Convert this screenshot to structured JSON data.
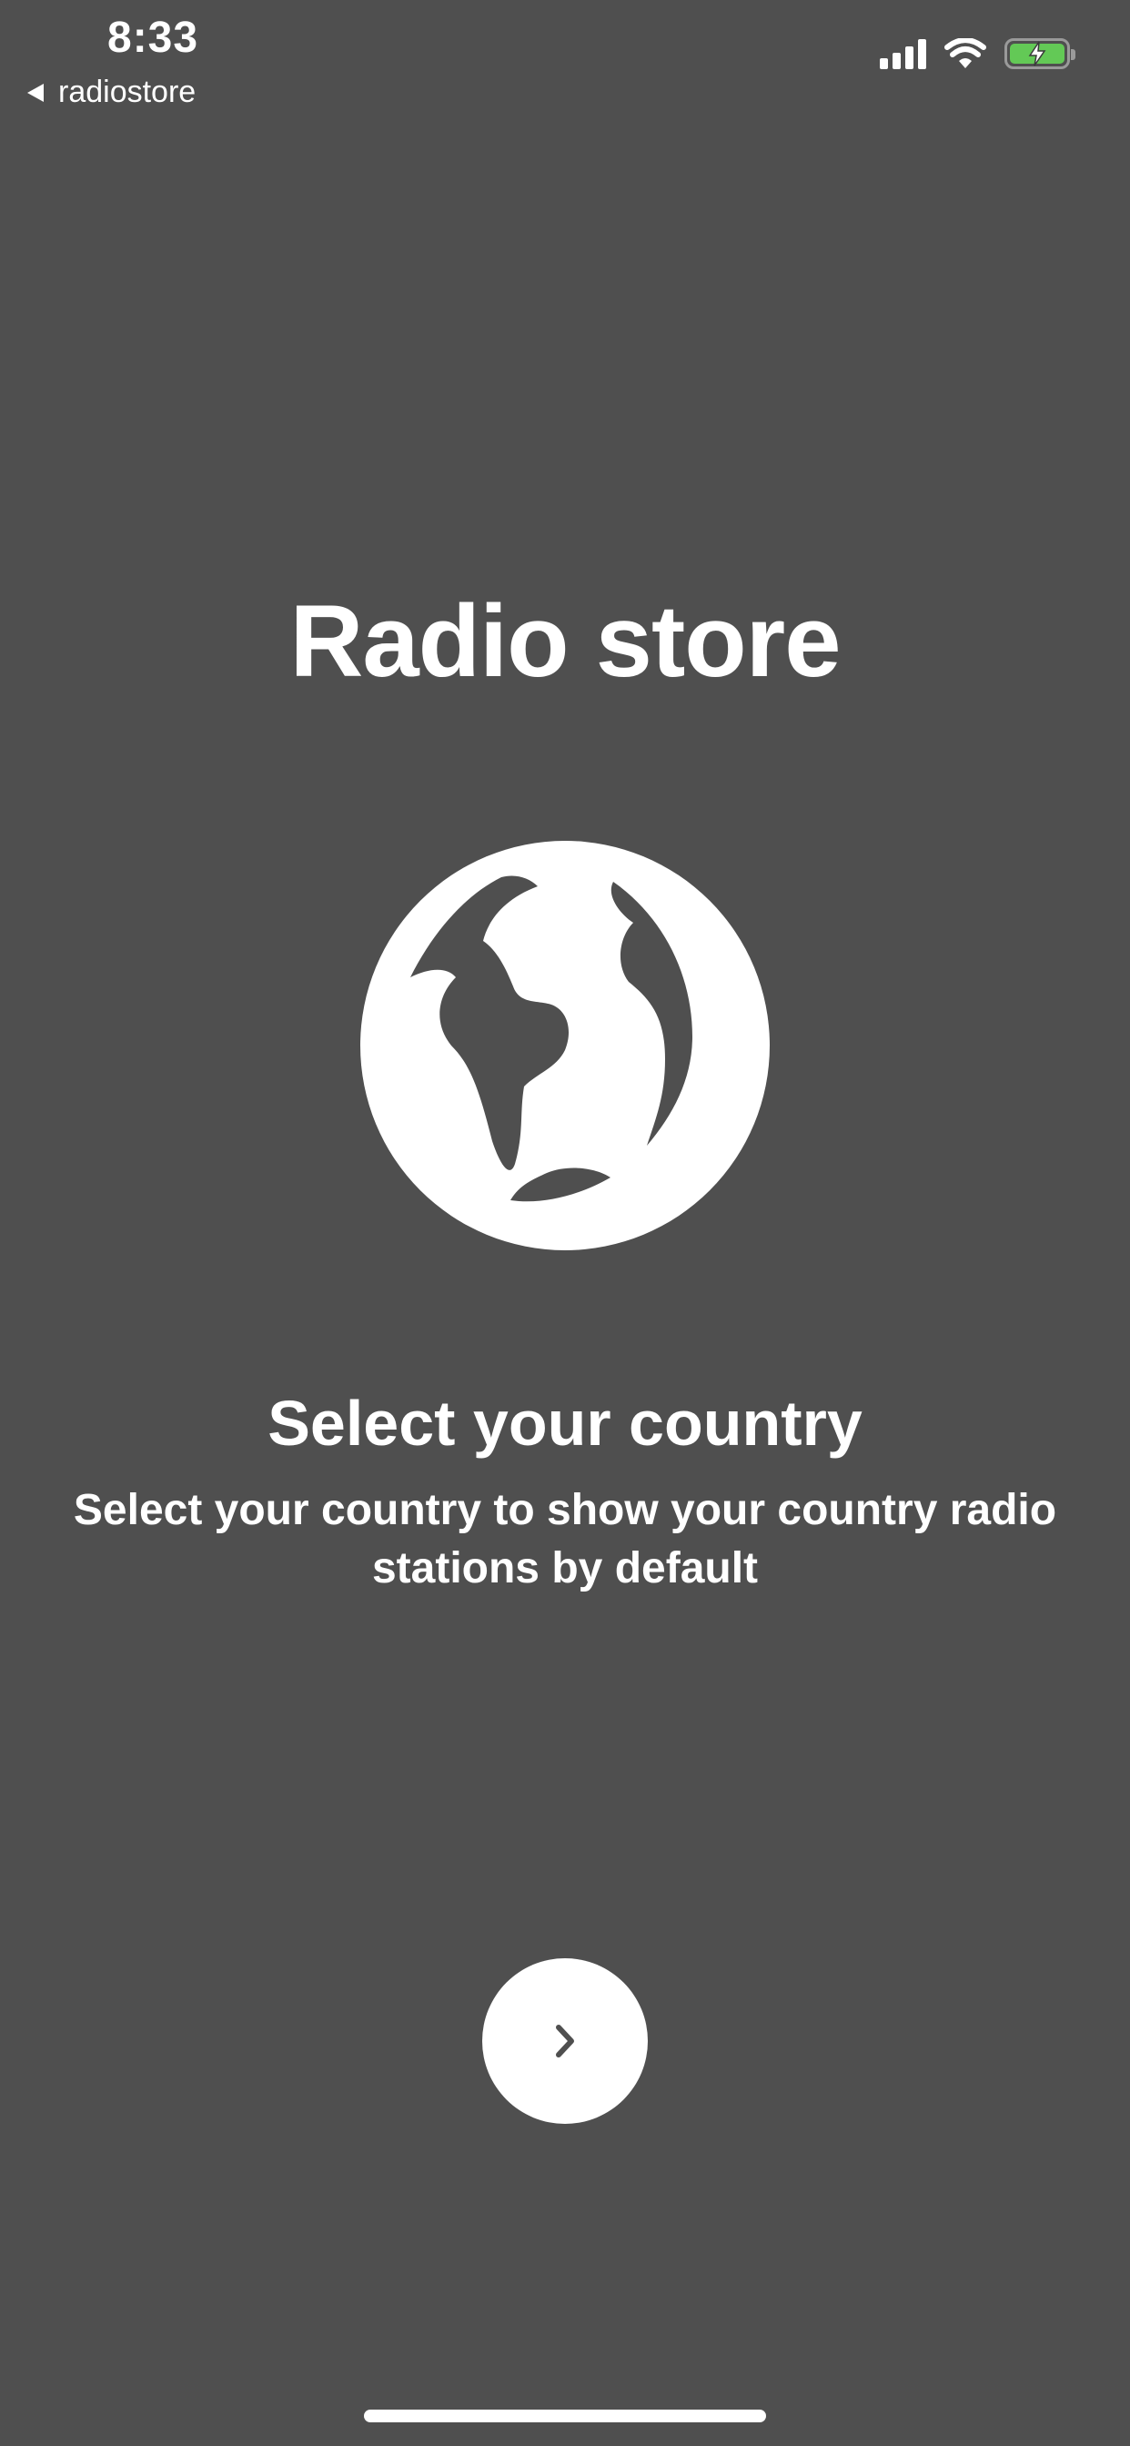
{
  "status_bar": {
    "time": "8:33",
    "back_app_label": "radiostore"
  },
  "onboarding": {
    "title": "Radio store",
    "icon": "globe-icon",
    "subtitle": "Select your country",
    "description": "Select your country to show your country radio stations by default",
    "next_icon": "chevron-right-icon"
  },
  "colors": {
    "background": "#4f4f4f",
    "foreground": "#ffffff",
    "battery_fill": "#63c956"
  }
}
